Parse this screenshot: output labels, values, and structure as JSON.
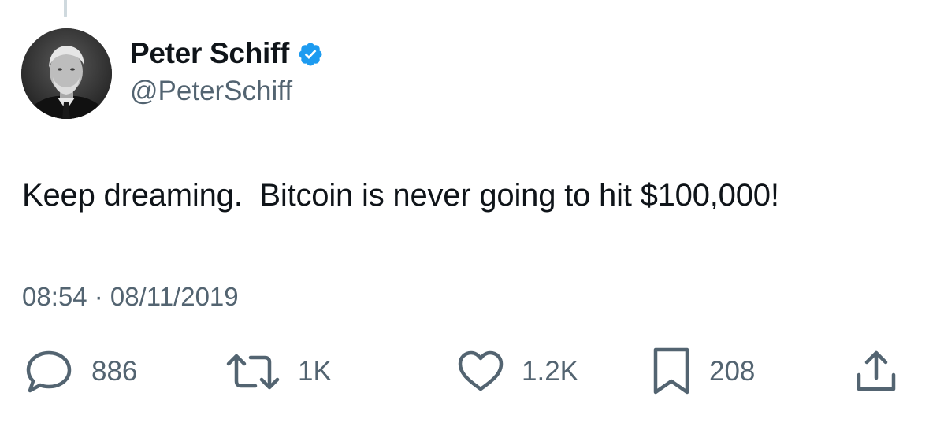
{
  "author": {
    "display_name": "Peter Schiff",
    "handle": "@PeterSchiff",
    "verified": true,
    "verified_color": "#1d9bf0"
  },
  "tweet": {
    "text": "Keep dreaming.  Bitcoin is never going to hit $100,000!",
    "time": "08:54",
    "separator": " · ",
    "date": "08/11/2019"
  },
  "actions": {
    "reply": {
      "icon": "reply-bubble-icon",
      "count": "886"
    },
    "retweet": {
      "icon": "retweet-arrows-icon",
      "count": "1K"
    },
    "like": {
      "icon": "heart-icon",
      "count": "1.2K"
    },
    "bookmark": {
      "icon": "bookmark-icon",
      "count": "208"
    },
    "share": {
      "icon": "share-upload-icon"
    }
  },
  "colors": {
    "text_primary": "#0f1419",
    "text_secondary": "#536471",
    "thread_line": "#cfd9de"
  }
}
